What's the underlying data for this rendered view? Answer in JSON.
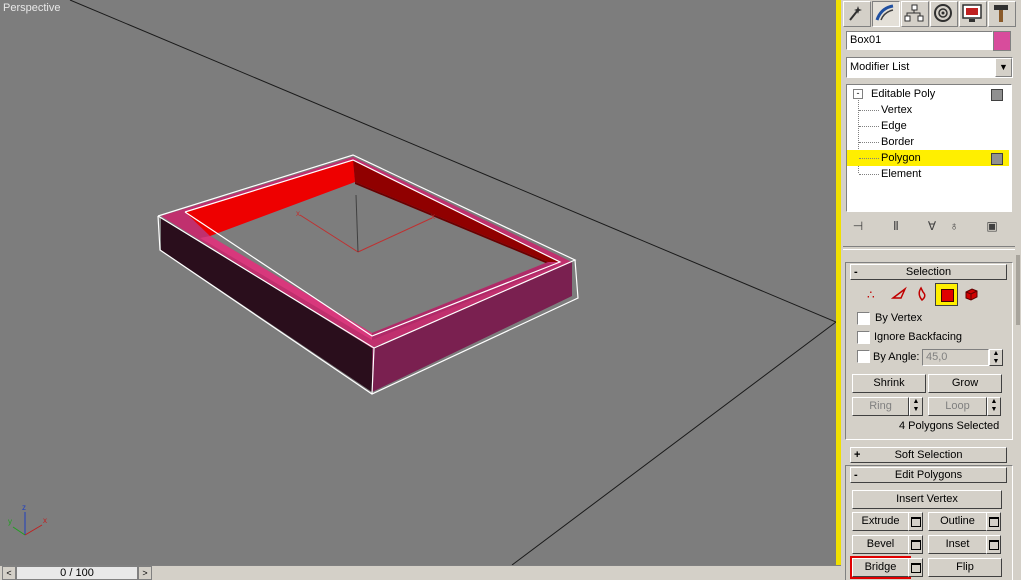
{
  "viewport": {
    "label": "Perspective"
  },
  "timeline": {
    "frame": "0 / 100",
    "prev_arrow": "<",
    "next_arrow": ">"
  },
  "panel": {
    "tabs": [
      "create",
      "modify",
      "hierarchy",
      "motion",
      "display",
      "utilities"
    ],
    "object_name": "Box01",
    "object_color": "#d84c9c",
    "modifier_list": "Modifier List",
    "stack": {
      "root": "Editable Poly",
      "items": [
        "Vertex",
        "Edge",
        "Border",
        "Polygon",
        "Element"
      ],
      "selected": "Polygon"
    },
    "selection": {
      "title": "Selection",
      "by_vertex": "By Vertex",
      "ignore_backfacing": "Ignore Backfacing",
      "by_angle": "By Angle:",
      "angle_value": "45,0",
      "shrink": "Shrink",
      "grow": "Grow",
      "ring": "Ring",
      "loop": "Loop",
      "status": "4 Polygons Selected"
    },
    "soft_selection": {
      "title": "Soft Selection"
    },
    "edit_polygons": {
      "title": "Edit Polygons",
      "insert_vertex": "Insert Vertex",
      "extrude": "Extrude",
      "outline": "Outline",
      "bevel": "Bevel",
      "inset": "Inset",
      "bridge": "Bridge",
      "flip": "Flip"
    },
    "rollout_toggles": {
      "expanded": "-",
      "collapsed": "+"
    }
  },
  "colors": {
    "selected_face": "#ff0000",
    "box_side": "#7a2050",
    "highlight": "#ffef00"
  }
}
